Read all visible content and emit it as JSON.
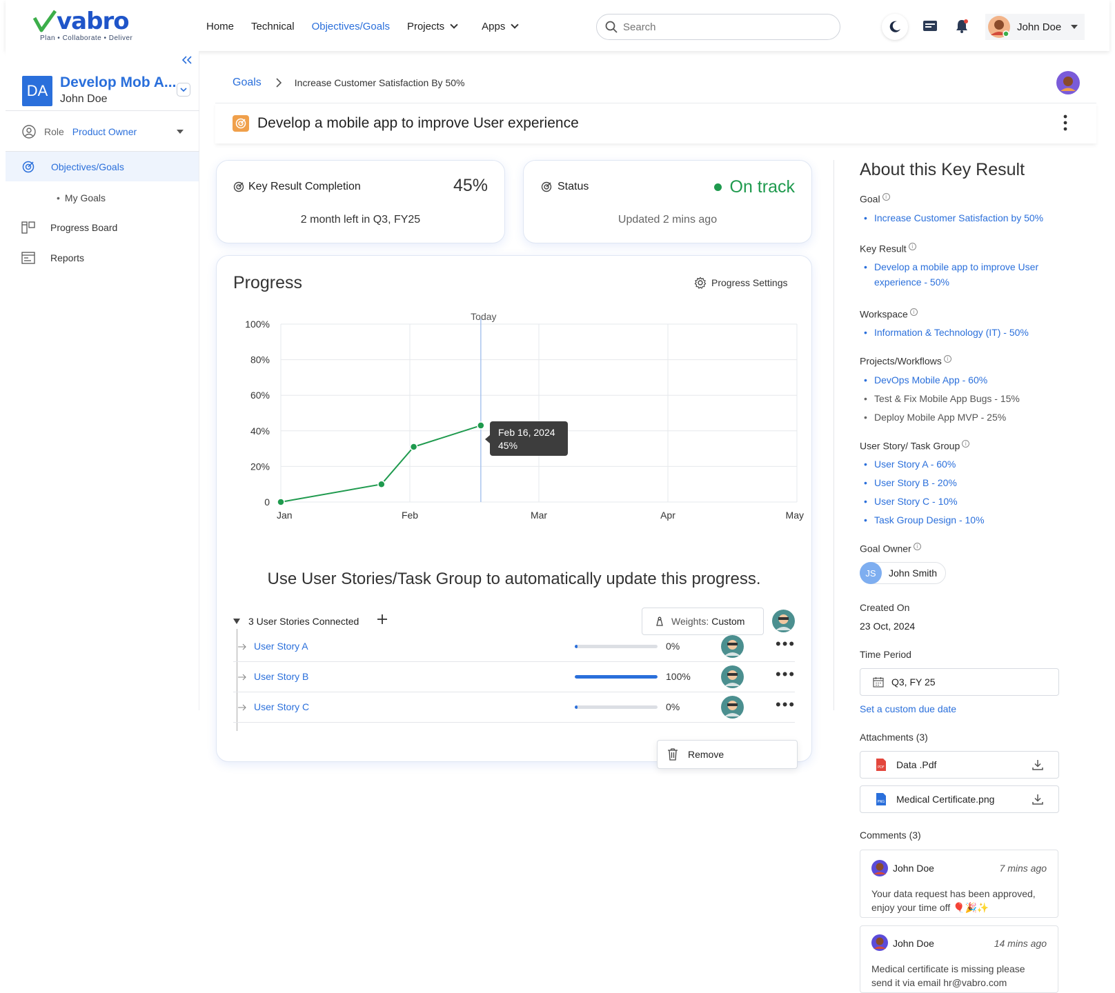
{
  "brand": {
    "name": "vabro",
    "tagline": "Plan • Collaborate • Deliver"
  },
  "nav": {
    "items": [
      "Home",
      "Technical",
      "Objectives/Goals",
      "Projects",
      "Apps"
    ],
    "active_index": 2
  },
  "search": {
    "placeholder": "Search"
  },
  "user": {
    "name": "John Doe"
  },
  "sidebar": {
    "workspace_initials": "DA",
    "workspace_title": "Develop Mob A...",
    "workspace_user": "John Doe",
    "role_label": "Role",
    "role_value": "Product Owner",
    "items": [
      "Objectives/Goals",
      "My Goals",
      "Progress Board",
      "Reports"
    ]
  },
  "breadcrumb": {
    "root": "Goals",
    "current": "Increase Customer Satisfaction By 50%"
  },
  "page_title": "Develop a mobile app to improve User experience",
  "completion_card": {
    "label": "Key Result Completion",
    "value": "45%",
    "subtitle": "2 month left in Q3, FY25"
  },
  "status_card": {
    "label": "Status",
    "value": "On track",
    "subtitle": "Updated 2 mins ago"
  },
  "progress": {
    "title": "Progress",
    "settings_label": "Progress Settings",
    "today_label": "Today",
    "tooltip_date": "Feb 16, 2024",
    "tooltip_value": "45%"
  },
  "chart_data": {
    "type": "line",
    "x_labels": [
      "Jan",
      "Feb",
      "Mar",
      "Apr",
      "May"
    ],
    "y_ticks": [
      "0",
      "20%",
      "40%",
      "60%",
      "80%",
      "100%"
    ],
    "ylim": [
      0,
      100
    ],
    "xlim": [
      0,
      4
    ],
    "points": [
      {
        "x": 0,
        "y": 0
      },
      {
        "x": 0.78,
        "y": 10
      },
      {
        "x": 1.03,
        "y": 31
      },
      {
        "x": 1.55,
        "y": 43
      }
    ],
    "today_x": 1.55,
    "line_color": "#1f9a4e"
  },
  "stories": {
    "banner": "Use User Stories/Task Group to automatically update this progress.",
    "connected_label": "3 User Stories Connected",
    "weights_label": "Weights",
    "weights_value": "Custom",
    "rows": [
      {
        "name": "User Story A",
        "progress": 0,
        "percent": "0%"
      },
      {
        "name": "User Story B",
        "progress": 100,
        "percent": "100%"
      },
      {
        "name": "User Story C",
        "progress": 0,
        "percent": "0%"
      }
    ],
    "menu_remove": "Remove"
  },
  "about": {
    "title": "About this Key Result",
    "goal_label": "Goal",
    "goal_items": [
      "Increase Customer Satisfaction by 50%"
    ],
    "kr_label": "Key Result",
    "kr_items": [
      "Develop a mobile app to improve User experience - 50%"
    ],
    "workspace_label": "Workspace",
    "workspace_items": [
      "Information & Technology (IT) - 50%"
    ],
    "projects_label": "Projects/Workflows",
    "projects_items": [
      "DevOps Mobile App - 60%",
      "Test & Fix Mobile App Bugs - 15%",
      "Deploy Mobile App MVP - 25%"
    ],
    "stories_label": "User Story/ Task Group",
    "stories_items": [
      "User Story A - 60%",
      "User Story B - 20%",
      "User Story C - 10%",
      "Task Group Design - 10%"
    ],
    "owner_label": "Goal Owner",
    "owner_initials": "JS",
    "owner_name": "John Smith",
    "created_label": "Created On",
    "created_value": "23 Oct, 2024",
    "period_label": "Time Period",
    "period_value": "Q3, FY 25",
    "custom_due": "Set a custom due date",
    "attachments_label": "Attachments (3)",
    "attachments": [
      "Data .Pdf",
      "Medical Certificate.png"
    ],
    "comments_label": "Comments (3)",
    "comments": [
      {
        "author": "John Doe",
        "time": "7 mins ago",
        "text": "Your data  request has been approved, enjoy your time off 🎈🎉✨"
      },
      {
        "author": "John Doe",
        "time": "14 mins ago",
        "text": "Medical certificate is missing please send it via email hr@vabro.com"
      }
    ]
  }
}
